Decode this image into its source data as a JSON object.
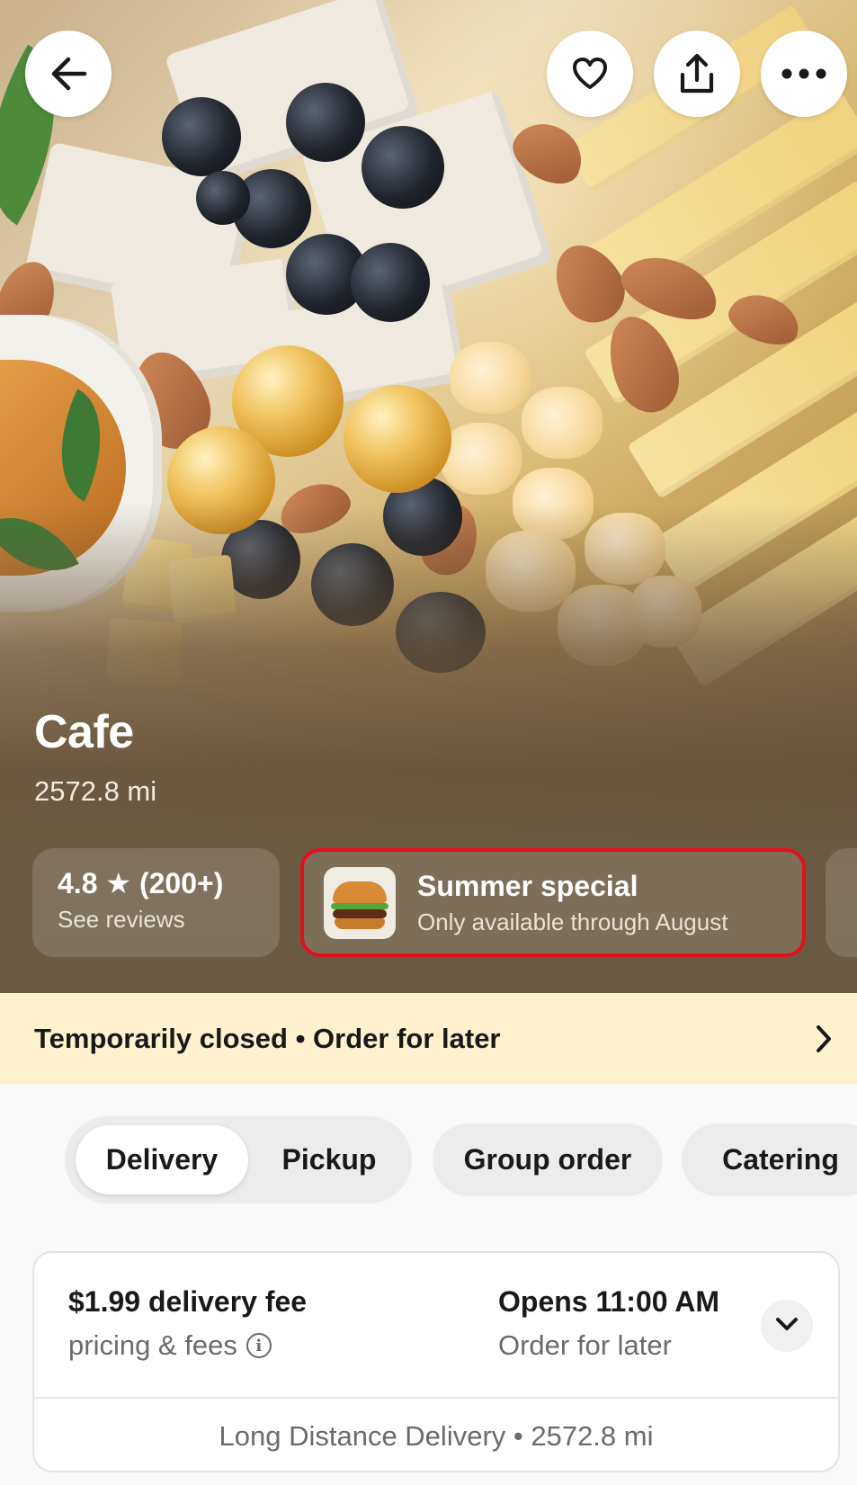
{
  "header": {
    "back_icon": "arrow-left-icon",
    "favorite_icon": "heart-icon",
    "share_icon": "share-icon",
    "more_icon": "more-horizontal-icon"
  },
  "store": {
    "name": "Cafe",
    "distance": "2572.8 mi",
    "rating": "4.8 ★ (200+)",
    "rating_link": "See reviews"
  },
  "promo": {
    "title": "Summer special",
    "subtitle": "Only available through August",
    "image_icon": "burger-icon",
    "highlight_color": "#e4101a"
  },
  "banner": {
    "text": "Temporarily closed • Order for later",
    "background": "#fdf2cd"
  },
  "tabs": {
    "delivery": "Delivery",
    "pickup": "Pickup",
    "group_order": "Group order",
    "catering": "Catering",
    "selected": "Delivery"
  },
  "delivery_info": {
    "fee": "$1.99 delivery fee",
    "fee_sub": "pricing & fees",
    "opens": "Opens 11:00 AM",
    "opens_sub": "Order for later",
    "footer": "Long Distance Delivery • 2572.8 mi"
  }
}
